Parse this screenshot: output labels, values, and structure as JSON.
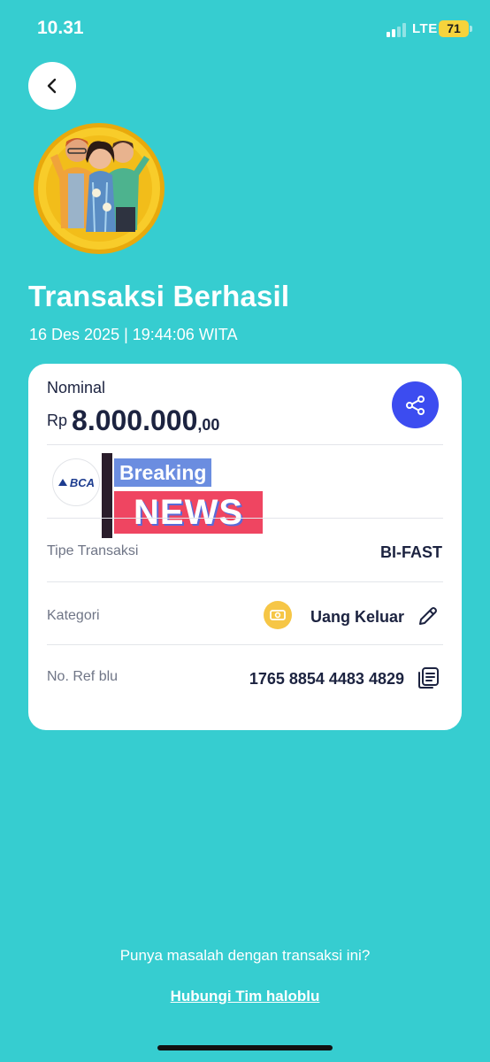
{
  "status_bar": {
    "time": "10.31",
    "network": "LTE",
    "battery": "71",
    "colors": {
      "battery": "#f6d33c"
    }
  },
  "header": {
    "back_icon": "chevron-left-icon",
    "hero_image": "three-people-avatar-badge"
  },
  "transaction": {
    "title": "Transaksi Berhasil",
    "datetime": "16 Des 2025 | 19:44:06 WITA"
  },
  "card": {
    "nominal_label": "Nominal",
    "currency": "Rp",
    "amount_main": "8.000.000",
    "amount_decimal": ",00",
    "share_icon": "share-icon",
    "bank_logo_text": "BCA",
    "overlay": {
      "top": "Breaking",
      "bottom": "NEWS"
    },
    "rows": [
      {
        "label": "Tipe Transaksi",
        "value": "BI-FAST"
      },
      {
        "label": "Kategori",
        "value": "Uang Keluar",
        "icon": "money-out-icon",
        "action_icon": "pencil-edit-icon"
      },
      {
        "label": "No. Ref blu",
        "value": "1765 8854 4483 4829",
        "action_icon": "copy-icon"
      }
    ]
  },
  "footer": {
    "help_text": "Punya masalah dengan transaksi ini?",
    "help_link": "Hubungi Tim haloblu"
  },
  "colors": {
    "background": "#36cdd0",
    "card": "#ffffff",
    "accent_button": "#3c4cf0",
    "text_dark": "#1c2340",
    "category_icon": "#f6c646"
  }
}
